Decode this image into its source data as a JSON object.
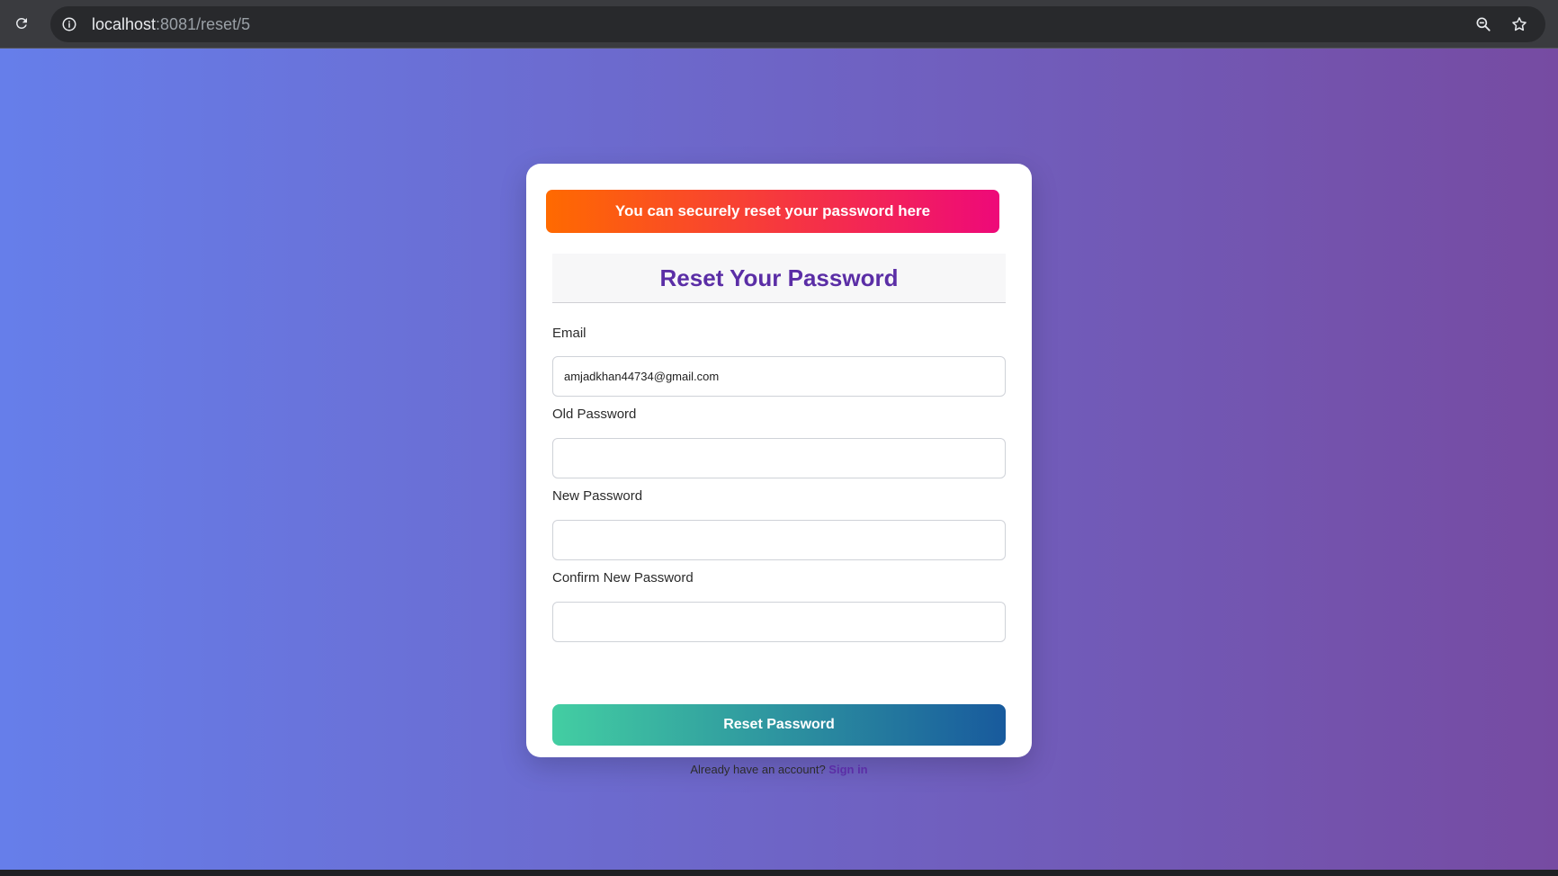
{
  "browser": {
    "url_host": "localhost",
    "url_rest": ":8081/reset/5"
  },
  "banner": {
    "text": "You can securely reset your password here"
  },
  "form": {
    "title": "Reset Your Password",
    "email_label": "Email",
    "email_value": "amjadkhan44734@gmail.com",
    "old_password_label": "Old Password",
    "old_password_value": "",
    "new_password_label": "New Password",
    "new_password_value": "",
    "confirm_password_label": "Confirm New Password",
    "confirm_password_value": "",
    "submit_label": "Reset Password",
    "footer_text": "Already have an account?",
    "signin_link": "Sign in"
  },
  "colors": {
    "background_start": "#667eea",
    "background_end": "#764ba2",
    "banner_start": "#ff6a00",
    "banner_end": "#ee0979",
    "title": "#5b2ea6",
    "button_start": "#43cea2",
    "button_end": "#185a9d"
  },
  "icons": {
    "reload": "reload-icon",
    "site_info": "info-icon",
    "zoom": "zoom-icon",
    "bookmark": "star-icon"
  }
}
